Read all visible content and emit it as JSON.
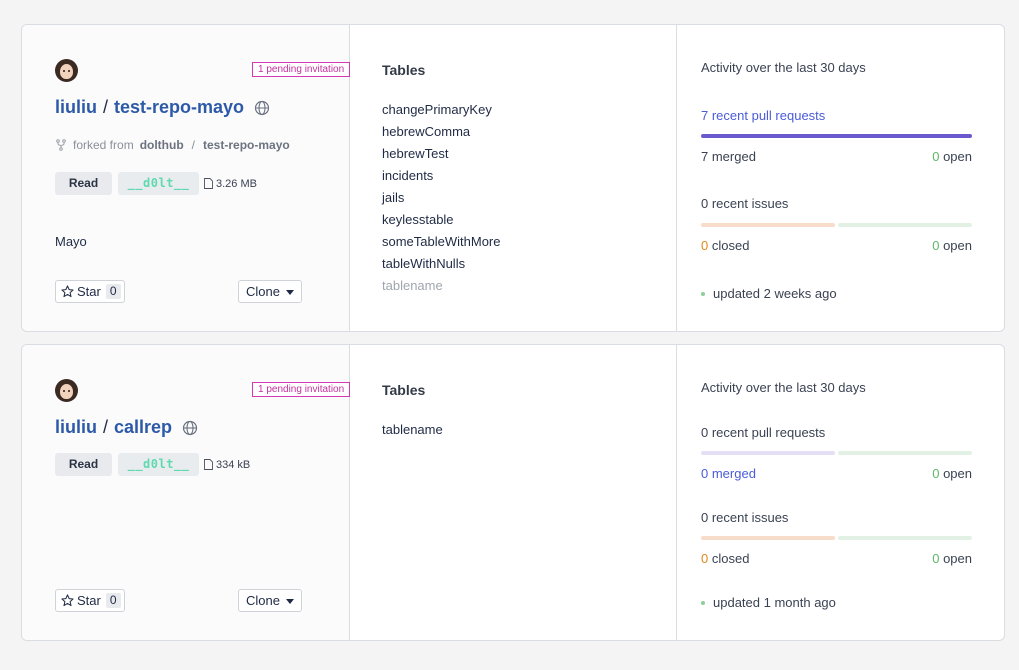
{
  "repos": [
    {
      "owner": "liuliu",
      "name": "test-repo-mayo",
      "separator": "/",
      "invitation": "1 pending invitation",
      "forked_from_label": "forked from",
      "forked_owner": "dolthub",
      "forked_repo": "test-repo-mayo",
      "fork_separator": "/",
      "access": "Read",
      "dolt_badge": "__d0lt__",
      "size": "3.26 MB",
      "description": "Mayo",
      "star_label": "Star",
      "star_count": "0",
      "clone_label": "Clone",
      "tables_heading": "Tables",
      "tables": [
        "changePrimaryKey",
        "hebrewComma",
        "hebrewTest",
        "incidents",
        "jails",
        "keylesstable",
        "someTableWithMore",
        "tableWithNulls",
        "tablename"
      ],
      "activity_heading": "Activity over the last 30 days",
      "pull_requests": "7 recent pull requests",
      "merged": "7 merged",
      "pr_open_count": "0",
      "open_label": " open",
      "issues": "0 recent issues",
      "closed_count": "0",
      "closed_label": " closed",
      "issue_open_count": "0",
      "updated": "updated 2 weeks ago"
    },
    {
      "owner": "liuliu",
      "name": "callrep",
      "separator": "/",
      "invitation": "1 pending invitation",
      "access": "Read",
      "dolt_badge": "__d0lt__",
      "size": "334 kB",
      "star_label": "Star",
      "star_count": "0",
      "clone_label": "Clone",
      "tables_heading": "Tables",
      "tables": [
        "tablename"
      ],
      "activity_heading": "Activity over the last 30 days",
      "pull_requests": "0 recent pull requests",
      "merged": "0 merged",
      "pr_open_count": "0",
      "open_label": " open",
      "issues": "0 recent issues",
      "closed_count": "0",
      "closed_label": " closed",
      "issue_open_count": "0",
      "updated": "updated 1 month ago"
    }
  ],
  "colors": {
    "pr_bar_full": "#6a5acd",
    "pr_bar_light": "#e4dff5",
    "issue_bar_closed": "#f7dcc9",
    "issue_bar_open": "#e3f1e4",
    "open_green": "#5fb769",
    "closed_orange": "#e08a1a",
    "invite_magenta": "#d33ab8"
  }
}
